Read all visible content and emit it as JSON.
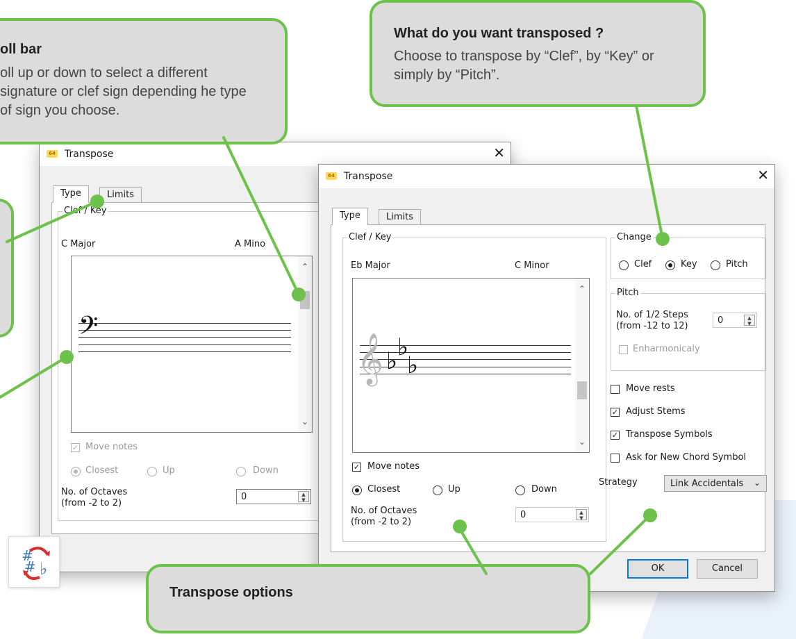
{
  "callouts": {
    "scroll_bar": {
      "title": "oll bar",
      "body": "oll up or down to select a different signature or clef sign depending he type of sign you choose."
    },
    "what_transposed": {
      "title": "What do you want transposed ?",
      "body": "Choose to transpose by “Clef”, by “Key” or simply by “Pitch”."
    },
    "transpose_options": {
      "title": "Transpose options"
    }
  },
  "dialog_back": {
    "title": "Transpose",
    "tabs": [
      "Type",
      "Limits"
    ],
    "group_label": "Clef / Key",
    "key_major": "C Major",
    "key_minor": "A Mino",
    "move_notes": "Move notes",
    "closest": "Closest",
    "up": "Up",
    "down": "Down",
    "octaves_label_1": "No. of Octaves",
    "octaves_label_2": "(from -2 to 2)",
    "octaves_value": "0"
  },
  "dialog_front": {
    "title": "Transpose",
    "tabs": [
      "Type",
      "Limits"
    ],
    "group_label": "Clef / Key",
    "key_major": "Eb Major",
    "key_minor": "C Minor",
    "move_notes": "Move notes",
    "closest": "Closest",
    "up": "Up",
    "down": "Down",
    "octaves_label_1": "No. of Octaves",
    "octaves_label_2": "(from -2 to 2)",
    "octaves_value": "0",
    "change": {
      "label": "Change",
      "clef": "Clef",
      "key": "Key",
      "pitch": "Pitch",
      "selected": "Key"
    },
    "pitch": {
      "label": "Pitch",
      "steps_label_1": "No. of 1/2 Steps",
      "steps_label_2": "(from -12 to 12)",
      "steps_value": "0",
      "enharmonic": "Enharmonicaly"
    },
    "move_rests": "Move rests",
    "adjust_stems": "Adjust Stems",
    "transpose_symbols": "Transpose Symbols",
    "ask_chord": "Ask for New Chord Symbol",
    "strategy_label": "Strategy",
    "strategy_value": "Link Accidentals",
    "ok": "OK",
    "cancel": "Cancel"
  },
  "icons": {
    "close": "close-icon",
    "app": "app-icon",
    "logo": "transpose-logo-icon"
  },
  "colors": {
    "callout_border": "#6cc24a",
    "callout_fill": "#dcdcdc",
    "default_button_border": "#0078d7"
  }
}
